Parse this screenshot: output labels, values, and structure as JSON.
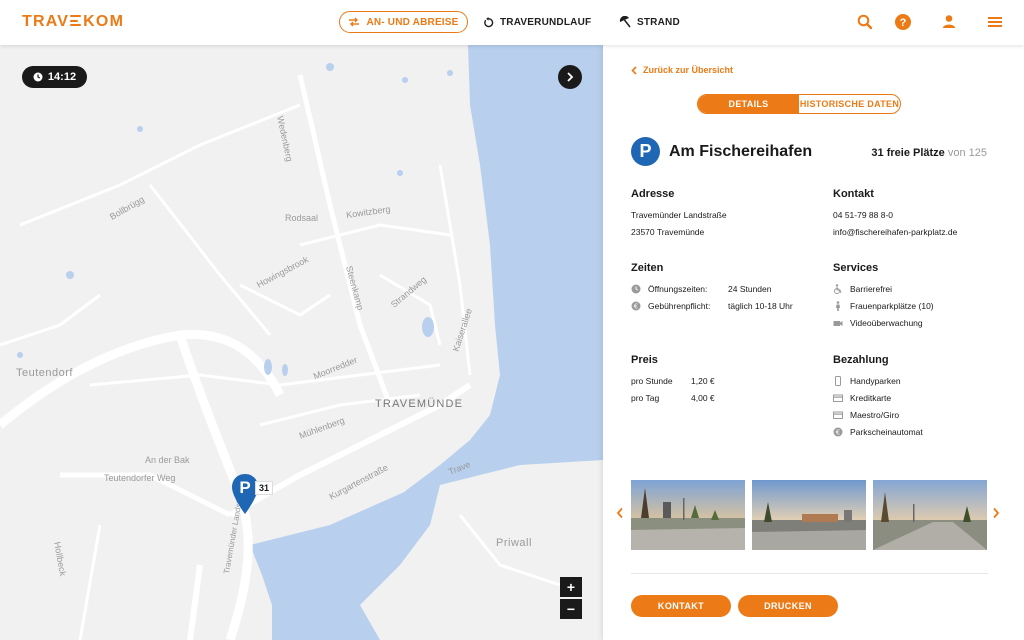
{
  "header": {
    "logo": "TRAVEKOM",
    "logo_prefix": "TRAV",
    "logo_suffix": "KOM",
    "nav": [
      {
        "label": "AN- UND ABREISE",
        "icon": "swap-arrows-icon",
        "active": true
      },
      {
        "label": "TRAVERUNDLAUF",
        "icon": "rotate-icon"
      },
      {
        "label": "STRAND",
        "icon": "beach-umbrella-icon"
      }
    ],
    "icons": [
      "search-icon",
      "help-icon",
      "user-icon",
      "menu-icon"
    ],
    "accent_color": "#ec7a16"
  },
  "map": {
    "time": "14:12",
    "labels": {
      "wedenberg": "Wedenberg",
      "bollbrugg": "Bollbrügg",
      "rodsaal": "Rodsaal",
      "kowitzberg": "Kowitzberg",
      "howingsbrook": "Howingsbrook",
      "steenkamp": "Steenkamp",
      "strandweg": "Strandweg",
      "kaiserallee": "Kaiserallee",
      "teutendorf": "Teutendorf",
      "moorredder": "Moorredder",
      "travemuende": "TRAVEMÜNDE",
      "muehlenberg": "Mühlenberg",
      "an_der_bak": "An der Bak",
      "teutendorfer_weg": "Teutendorfer Weg",
      "kurgartenstrasse": "Kurgartenstraße",
      "trave": "Trave",
      "priwall": "Priwall",
      "hollbeck": "Hollbeck",
      "landstrasse": "Travemünder Landstraße"
    },
    "marker": {
      "letter": "P",
      "count": "31"
    },
    "zoom_in": "+",
    "zoom_out": "−",
    "water_color": "#b8cfee",
    "land_color": "#f1f1f1"
  },
  "panel": {
    "back": "Zurück zur Übersicht",
    "tabs": [
      {
        "label": "DETAILS",
        "active": true
      },
      {
        "label": "HISTORISCHE DATEN",
        "active": false
      }
    ],
    "title": "Am Fischereihafen",
    "free": "31 freie Plätze",
    "of": "von 125",
    "address": {
      "heading": "Adresse",
      "street": "Travemünder Landstraße",
      "city": "23570 Travemünde"
    },
    "contact": {
      "heading": "Kontakt",
      "phone": "04 51-79 88 8-0",
      "email": "info@fischereihafen-parkplatz.de"
    },
    "times": {
      "heading": "Zeiten",
      "rows": [
        {
          "key": "Öffnungszeiten:",
          "value": "24 Stunden",
          "icon": "clock-icon"
        },
        {
          "key": "Gebührenpflicht:",
          "value": "täglich 10-18 Uhr",
          "icon": "euro-icon"
        }
      ]
    },
    "services": {
      "heading": "Services",
      "items": [
        {
          "label": "Barrierefrei",
          "icon": "wheelchair-icon"
        },
        {
          "label": "Frauenparkplätze (10)",
          "icon": "woman-icon"
        },
        {
          "label": "Videoüberwachung",
          "icon": "camera-icon"
        }
      ]
    },
    "price": {
      "heading": "Preis",
      "rows": [
        {
          "key": "pro Stunde",
          "value": "1,20 €"
        },
        {
          "key": "pro Tag",
          "value": "4,00 €"
        }
      ]
    },
    "payment": {
      "heading": "Bezahlung",
      "items": [
        {
          "label": "Handyparken",
          "icon": "phone-icon"
        },
        {
          "label": "Kreditkarte",
          "icon": "credit-card-icon"
        },
        {
          "label": "Maestro/Giro",
          "icon": "debit-card-icon"
        },
        {
          "label": "Parkscheinautomat",
          "icon": "euro-coin-icon"
        }
      ]
    },
    "buttons": {
      "contact": "KONTAKT",
      "print": "DRUCKEN"
    },
    "marker_color": "#1f67b4"
  }
}
